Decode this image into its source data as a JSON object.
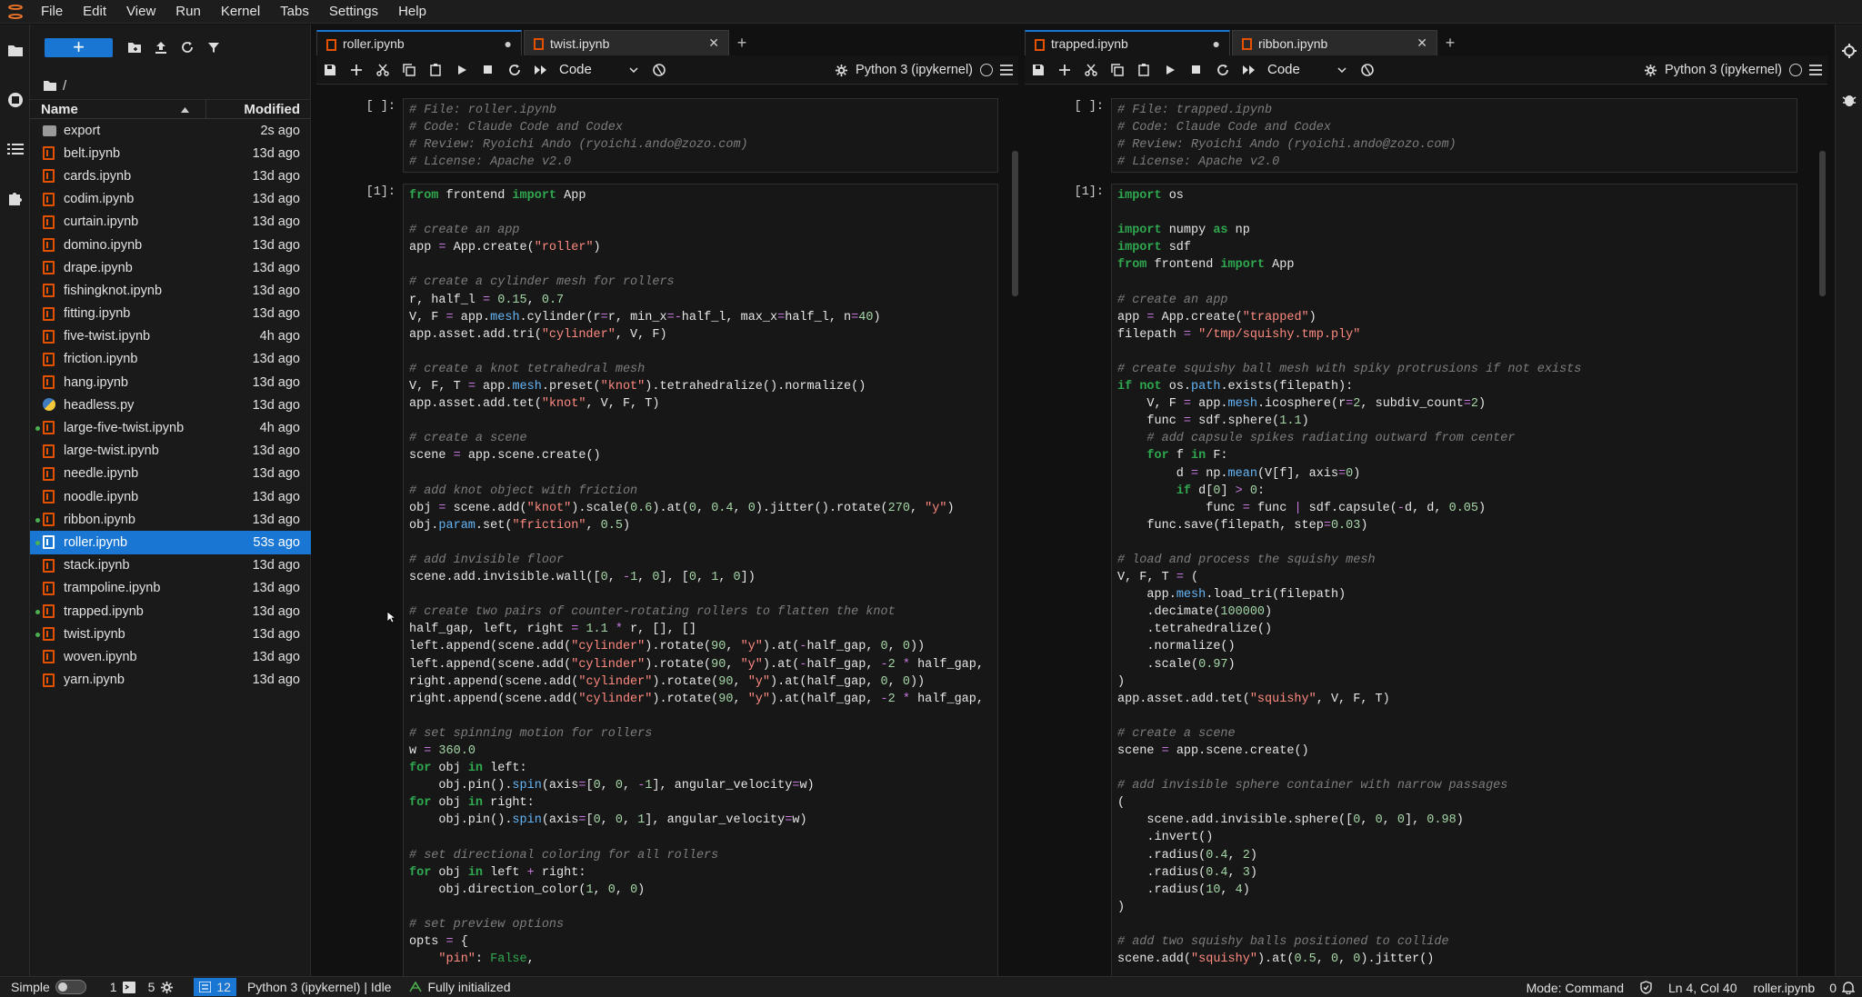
{
  "menu": [
    "File",
    "Edit",
    "View",
    "Run",
    "Kernel",
    "Tabs",
    "Settings",
    "Help"
  ],
  "filebrowser": {
    "path": "/",
    "col_name": "Name",
    "col_modified": "Modified",
    "files": [
      {
        "name": "export",
        "mod": "2s ago",
        "kind": "folder",
        "running": false
      },
      {
        "name": "belt.ipynb",
        "mod": "13d ago",
        "kind": "notebook",
        "running": false
      },
      {
        "name": "cards.ipynb",
        "mod": "13d ago",
        "kind": "notebook",
        "running": false
      },
      {
        "name": "codim.ipynb",
        "mod": "13d ago",
        "kind": "notebook",
        "running": false
      },
      {
        "name": "curtain.ipynb",
        "mod": "13d ago",
        "kind": "notebook",
        "running": false
      },
      {
        "name": "domino.ipynb",
        "mod": "13d ago",
        "kind": "notebook",
        "running": false
      },
      {
        "name": "drape.ipynb",
        "mod": "13d ago",
        "kind": "notebook",
        "running": false
      },
      {
        "name": "fishingknot.ipynb",
        "mod": "13d ago",
        "kind": "notebook",
        "running": false
      },
      {
        "name": "fitting.ipynb",
        "mod": "13d ago",
        "kind": "notebook",
        "running": false
      },
      {
        "name": "five-twist.ipynb",
        "mod": "4h ago",
        "kind": "notebook",
        "running": false
      },
      {
        "name": "friction.ipynb",
        "mod": "13d ago",
        "kind": "notebook",
        "running": false
      },
      {
        "name": "hang.ipynb",
        "mod": "13d ago",
        "kind": "notebook",
        "running": false
      },
      {
        "name": "headless.py",
        "mod": "13d ago",
        "kind": "python",
        "running": false
      },
      {
        "name": "large-five-twist.ipynb",
        "mod": "4h ago",
        "kind": "notebook",
        "running": true
      },
      {
        "name": "large-twist.ipynb",
        "mod": "13d ago",
        "kind": "notebook",
        "running": false
      },
      {
        "name": "needle.ipynb",
        "mod": "13d ago",
        "kind": "notebook",
        "running": false
      },
      {
        "name": "noodle.ipynb",
        "mod": "13d ago",
        "kind": "notebook",
        "running": false
      },
      {
        "name": "ribbon.ipynb",
        "mod": "13d ago",
        "kind": "notebook",
        "running": true
      },
      {
        "name": "roller.ipynb",
        "mod": "53s ago",
        "kind": "notebook",
        "running": true,
        "selected": true
      },
      {
        "name": "stack.ipynb",
        "mod": "13d ago",
        "kind": "notebook",
        "running": false
      },
      {
        "name": "trampoline.ipynb",
        "mod": "13d ago",
        "kind": "notebook",
        "running": false
      },
      {
        "name": "trapped.ipynb",
        "mod": "13d ago",
        "kind": "notebook",
        "running": true
      },
      {
        "name": "twist.ipynb",
        "mod": "13d ago",
        "kind": "notebook",
        "running": true
      },
      {
        "name": "woven.ipynb",
        "mod": "13d ago",
        "kind": "notebook",
        "running": false
      },
      {
        "name": "yarn.ipynb",
        "mod": "13d ago",
        "kind": "notebook",
        "running": false
      }
    ]
  },
  "left": {
    "tabs": [
      {
        "label": "roller.ipynb",
        "active": true,
        "state": "●"
      },
      {
        "label": "twist.ipynb",
        "active": false,
        "state": "✕"
      }
    ],
    "celltype": "Code",
    "kernel": "Python 3 (ipykernel)",
    "cells": [
      {
        "prompt": "[ ]:",
        "code": "# File: roller.ipynb\n# Code: Claude Code and Codex\n# Review: Ryoichi Ando (ryoichi.ando@zozo.com)\n# License: Apache v2.0"
      },
      {
        "prompt": "[1]:",
        "code": "from frontend import App\n\n# create an app\napp = App.create(\"roller\")\n\n# create a cylinder mesh for rollers\nr, half_l = 0.15, 0.7\nV, F = app.mesh.cylinder(r=r, min_x=-half_l, max_x=half_l, n=40)\napp.asset.add.tri(\"cylinder\", V, F)\n\n# create a knot tetrahedral mesh\nV, F, T = app.mesh.preset(\"knot\").tetrahedralize().normalize()\napp.asset.add.tet(\"knot\", V, F, T)\n\n# create a scene\nscene = app.scene.create()\n\n# add knot object with friction\nobj = scene.add(\"knot\").scale(0.6).at(0, 0.4, 0).jitter().rotate(270, \"y\")\nobj.param.set(\"friction\", 0.5)\n\n# add invisible floor\nscene.add.invisible.wall([0, -1, 0], [0, 1, 0])\n\n# create two pairs of counter-rotating rollers to flatten the knot\nhalf_gap, left, right = 1.1 * r, [], []\nleft.append(scene.add(\"cylinder\").rotate(90, \"y\").at(-half_gap, 0, 0))\nleft.append(scene.add(\"cylinder\").rotate(90, \"y\").at(-half_gap, -2 * half_gap,\nright.append(scene.add(\"cylinder\").rotate(90, \"y\").at(half_gap, 0, 0))\nright.append(scene.add(\"cylinder\").rotate(90, \"y\").at(half_gap, -2 * half_gap,\n\n# set spinning motion for rollers\nw = 360.0\nfor obj in left:\n    obj.pin().spin(axis=[0, 0, -1], angular_velocity=w)\nfor obj in right:\n    obj.pin().spin(axis=[0, 0, 1], angular_velocity=w)\n\n# set directional coloring for all rollers\nfor obj in left + right:\n    obj.direction_color(1, 0, 0)\n\n# set preview options\nopts = {\n    \"pin\": False,"
      }
    ]
  },
  "right": {
    "tabs": [
      {
        "label": "trapped.ipynb",
        "active": true,
        "state": "●"
      },
      {
        "label": "ribbon.ipynb",
        "active": false,
        "state": "✕"
      }
    ],
    "celltype": "Code",
    "kernel": "Python 3 (ipykernel)",
    "cells": [
      {
        "prompt": "[ ]:",
        "code": "# File: trapped.ipynb\n# Code: Claude Code and Codex\n# Review: Ryoichi Ando (ryoichi.ando@zozo.com)\n# License: Apache v2.0"
      },
      {
        "prompt": "[1]:",
        "code": "import os\n\nimport numpy as np\nimport sdf\nfrom frontend import App\n\n# create an app\napp = App.create(\"trapped\")\nfilepath = \"/tmp/squishy.tmp.ply\"\n\n# create squishy ball mesh with spiky protrusions if not exists\nif not os.path.exists(filepath):\n    V, F = app.mesh.icosphere(r=2, subdiv_count=2)\n    func = sdf.sphere(1.1)\n    # add capsule spikes radiating outward from center\n    for f in F:\n        d = np.mean(V[f], axis=0)\n        if d[0] > 0:\n            func = func | sdf.capsule(-d, d, 0.05)\n    func.save(filepath, step=0.03)\n\n# load and process the squishy mesh\nV, F, T = (\n    app.mesh.load_tri(filepath)\n    .decimate(100000)\n    .tetrahedralize()\n    .normalize()\n    .scale(0.97)\n)\napp.asset.add.tet(\"squishy\", V, F, T)\n\n# create a scene\nscene = app.scene.create()\n\n# add invisible sphere container with narrow passages\n(\n    scene.add.invisible.sphere([0, 0, 0], 0.98)\n    .invert()\n    .radius(0.4, 2)\n    .radius(0.4, 3)\n    .radius(10, 4)\n)\n\n# add two squishy balls positioned to collide\nscene.add(\"squishy\").at(0.5, 0, 0).jitter()"
      }
    ]
  },
  "status": {
    "mode_label": "Simple",
    "terminals": "1",
    "kernels": "5",
    "cells": "12",
    "kernel_status": "Python 3 (ipykernel) | Idle",
    "init": "Fully initialized",
    "mode": "Mode: Command",
    "cursor": "Ln 4, Col 40",
    "file": "roller.ipynb",
    "notifications": "0"
  }
}
